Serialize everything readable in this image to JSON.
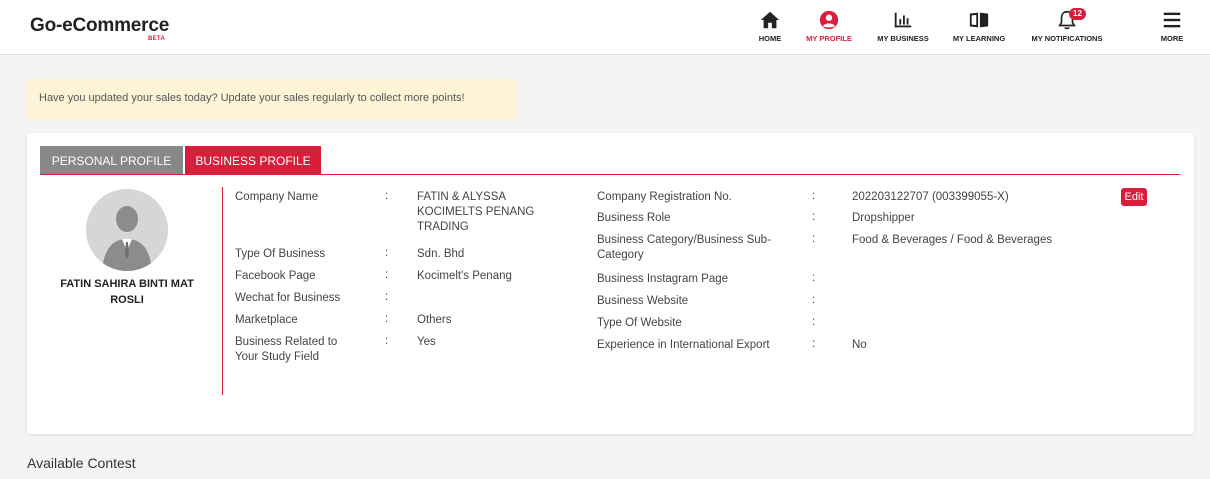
{
  "header": {
    "logo": "Go-eCommerce",
    "logo_badge": "BETA",
    "nav": {
      "home": "HOME",
      "profile": "MY PROFILE",
      "business": "MY BUSINESS",
      "learning": "MY LEARNING",
      "notifications": "MY NOTIFICATIONS",
      "notifications_count": "12",
      "more": "MORE"
    }
  },
  "banner": {
    "text": "Have you updated your sales today? Update your sales regularly to collect more points!"
  },
  "tabs": {
    "personal": "PERSONAL PROFILE",
    "business": "BUSINESS PROFILE"
  },
  "profile": {
    "name": "FATIN SAHIRA BINTI MAT ROSLI"
  },
  "left_fields": {
    "company_name": {
      "label": "Company Name",
      "value": "FATIN & ALYSSA KOCIMELTS PENANG TRADING"
    },
    "type_of_business": {
      "label": "Type Of Business",
      "value": "Sdn. Bhd"
    },
    "facebook_page": {
      "label": "Facebook Page",
      "value": "Kocimelt's Penang"
    },
    "wechat": {
      "label": "Wechat for Business",
      "value": ""
    },
    "marketplace": {
      "label": "Marketplace",
      "value": "Others"
    },
    "related_study": {
      "label": "Business Related to Your Study Field",
      "value": "Yes"
    }
  },
  "right_fields": {
    "registration_no": {
      "label": "Company Registration No.",
      "value": "202203122707 (003399055-X)"
    },
    "business_role": {
      "label": "Business Role",
      "value": "Dropshipper"
    },
    "category": {
      "label": "Business Category/Business Sub-Category",
      "value": "Food & Beverages / Food & Beverages"
    },
    "instagram": {
      "label": "Business Instagram Page",
      "value": ""
    },
    "website": {
      "label": "Business Website",
      "value": ""
    },
    "website_type": {
      "label": "Type Of Website",
      "value": ""
    },
    "export_experience": {
      "label": "Experience in International Export",
      "value": "No"
    }
  },
  "colon": ":",
  "edit_label": "Edit",
  "section": {
    "available_contest": "Available Contest"
  },
  "colors": {
    "accent": "#d81e3a",
    "banner_bg": "#fdf3d6",
    "tab_inactive": "#888888"
  },
  "icons": {
    "home": "home-icon",
    "profile": "user-circle-icon",
    "business": "bar-chart-icon",
    "learning": "book-icon",
    "notifications": "bell-icon",
    "more": "hamburger-menu-icon"
  }
}
